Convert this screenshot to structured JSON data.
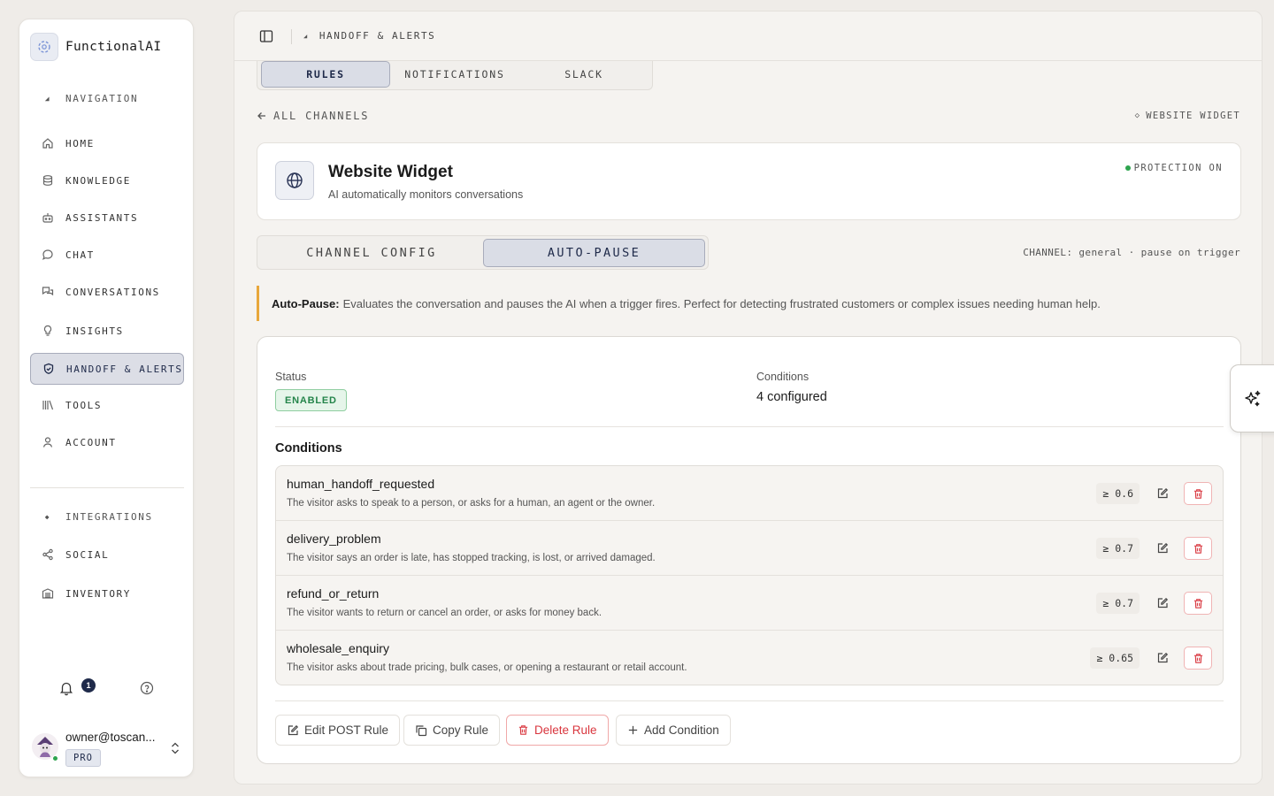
{
  "brand": {
    "name": "FunctionalAI"
  },
  "sidebar": {
    "navigation_label": "NAVIGATION",
    "items": [
      {
        "label": "HOME",
        "icon": "home-icon"
      },
      {
        "label": "KNOWLEDGE",
        "icon": "database-icon"
      },
      {
        "label": "ASSISTANTS",
        "icon": "bot-icon"
      },
      {
        "label": "CHAT",
        "icon": "chat-bubble-icon"
      },
      {
        "label": "CONVERSATIONS",
        "icon": "conversations-icon"
      },
      {
        "label": "INSIGHTS",
        "icon": "lightbulb-icon"
      },
      {
        "label": "HANDOFF & ALERTS",
        "icon": "shield-icon",
        "active": true
      },
      {
        "label": "TOOLS",
        "icon": "tools-icon"
      },
      {
        "label": "ACCOUNT",
        "icon": "user-icon"
      }
    ],
    "integrations_label": "INTEGRATIONS",
    "extra_items": [
      {
        "label": "SOCIAL",
        "icon": "share-icon"
      },
      {
        "label": "INVENTORY",
        "icon": "inventory-icon"
      }
    ],
    "notifications_count": "1",
    "user": {
      "email": "owner@toscan...",
      "plan": "PRO"
    }
  },
  "topbar": {
    "breadcrumb": "HANDOFF & ALERTS"
  },
  "tabs_top": [
    {
      "label": "RULES",
      "active": true
    },
    {
      "label": "NOTIFICATIONS",
      "active": false
    },
    {
      "label": "SLACK",
      "active": false
    }
  ],
  "nav": {
    "back_label": "ALL CHANNELS",
    "channel_tag": "WEBSITE WIDGET"
  },
  "channel": {
    "title": "Website Widget",
    "subtitle": "AI automatically monitors conversations",
    "protection": "PROTECTION ON",
    "status_color": "#2ea44f"
  },
  "tabs_mid": [
    {
      "label": "CHANNEL CONFIG",
      "active": false
    },
    {
      "label": "AUTO-PAUSE",
      "active": true
    }
  ],
  "channel_meta": "CHANNEL: general · pause on trigger",
  "info": {
    "title": "Auto-Pause:",
    "text": "Evaluates the conversation and pauses the AI when a trigger fires. Perfect for detecting frustrated customers or complex issues needing human help."
  },
  "rule": {
    "status_label": "Status",
    "status_value": "ENABLED",
    "conditions_label": "Conditions",
    "conditions_value": "4 configured",
    "conditions_heading": "Conditions",
    "conditions": [
      {
        "name": "human_handoff_requested",
        "desc": "The visitor asks to speak to a person, or asks for a human, an agent or the owner.",
        "threshold": "≥ 0.6"
      },
      {
        "name": "delivery_problem",
        "desc": "The visitor says an order is late, has stopped tracking, is lost, or arrived damaged.",
        "threshold": "≥ 0.7"
      },
      {
        "name": "refund_or_return",
        "desc": "The visitor wants to return or cancel an order, or asks for money back.",
        "threshold": "≥ 0.7"
      },
      {
        "name": "wholesale_enquiry",
        "desc": "The visitor asks about trade pricing, bulk cases, or opening a restaurant or retail account.",
        "threshold": "≥ 0.65"
      }
    ],
    "actions": {
      "edit": "Edit POST Rule",
      "copy": "Copy Rule",
      "delete": "Delete Rule",
      "add": "Add Condition"
    }
  },
  "colors": {
    "accent": "#1f2a4a",
    "success": "#2ea44f",
    "danger": "#d9363e",
    "warning": "#e8a73b"
  }
}
